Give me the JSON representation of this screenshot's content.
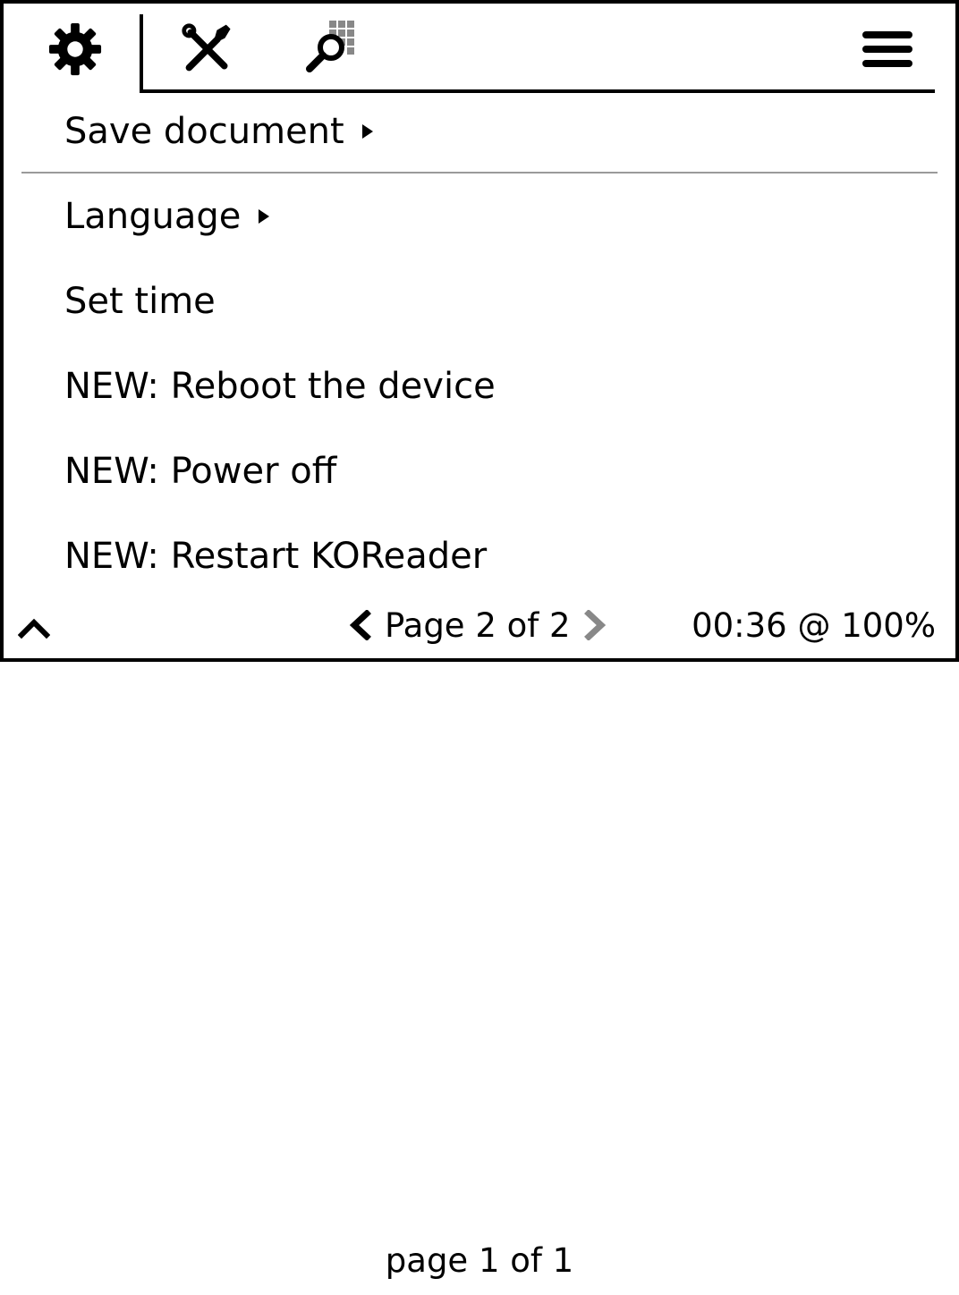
{
  "tabs": [
    {
      "icon": "gear-icon",
      "selected": true
    },
    {
      "icon": "tools-icon",
      "selected": false
    },
    {
      "icon": "search-icon",
      "selected": false
    },
    {
      "icon": "hamburger-menu-icon",
      "selected": false
    }
  ],
  "menu": {
    "items": [
      {
        "label": "Save document",
        "submenu": true
      },
      {
        "label": "Language",
        "submenu": true
      },
      {
        "label": "Set time",
        "submenu": false
      },
      {
        "label": "NEW: Reboot the device",
        "submenu": false
      },
      {
        "label": "NEW: Power off",
        "submenu": false
      },
      {
        "label": "NEW: Restart KOReader",
        "submenu": false
      }
    ]
  },
  "footer": {
    "page_label": "Page 2 of 2",
    "clock": "00:36 @ 100%"
  },
  "page_footer": "page 1 of 1",
  "colors": {
    "foreground": "#000000",
    "background": "#ffffff",
    "separator": "#9a9a9a",
    "disabled": "#888888"
  }
}
